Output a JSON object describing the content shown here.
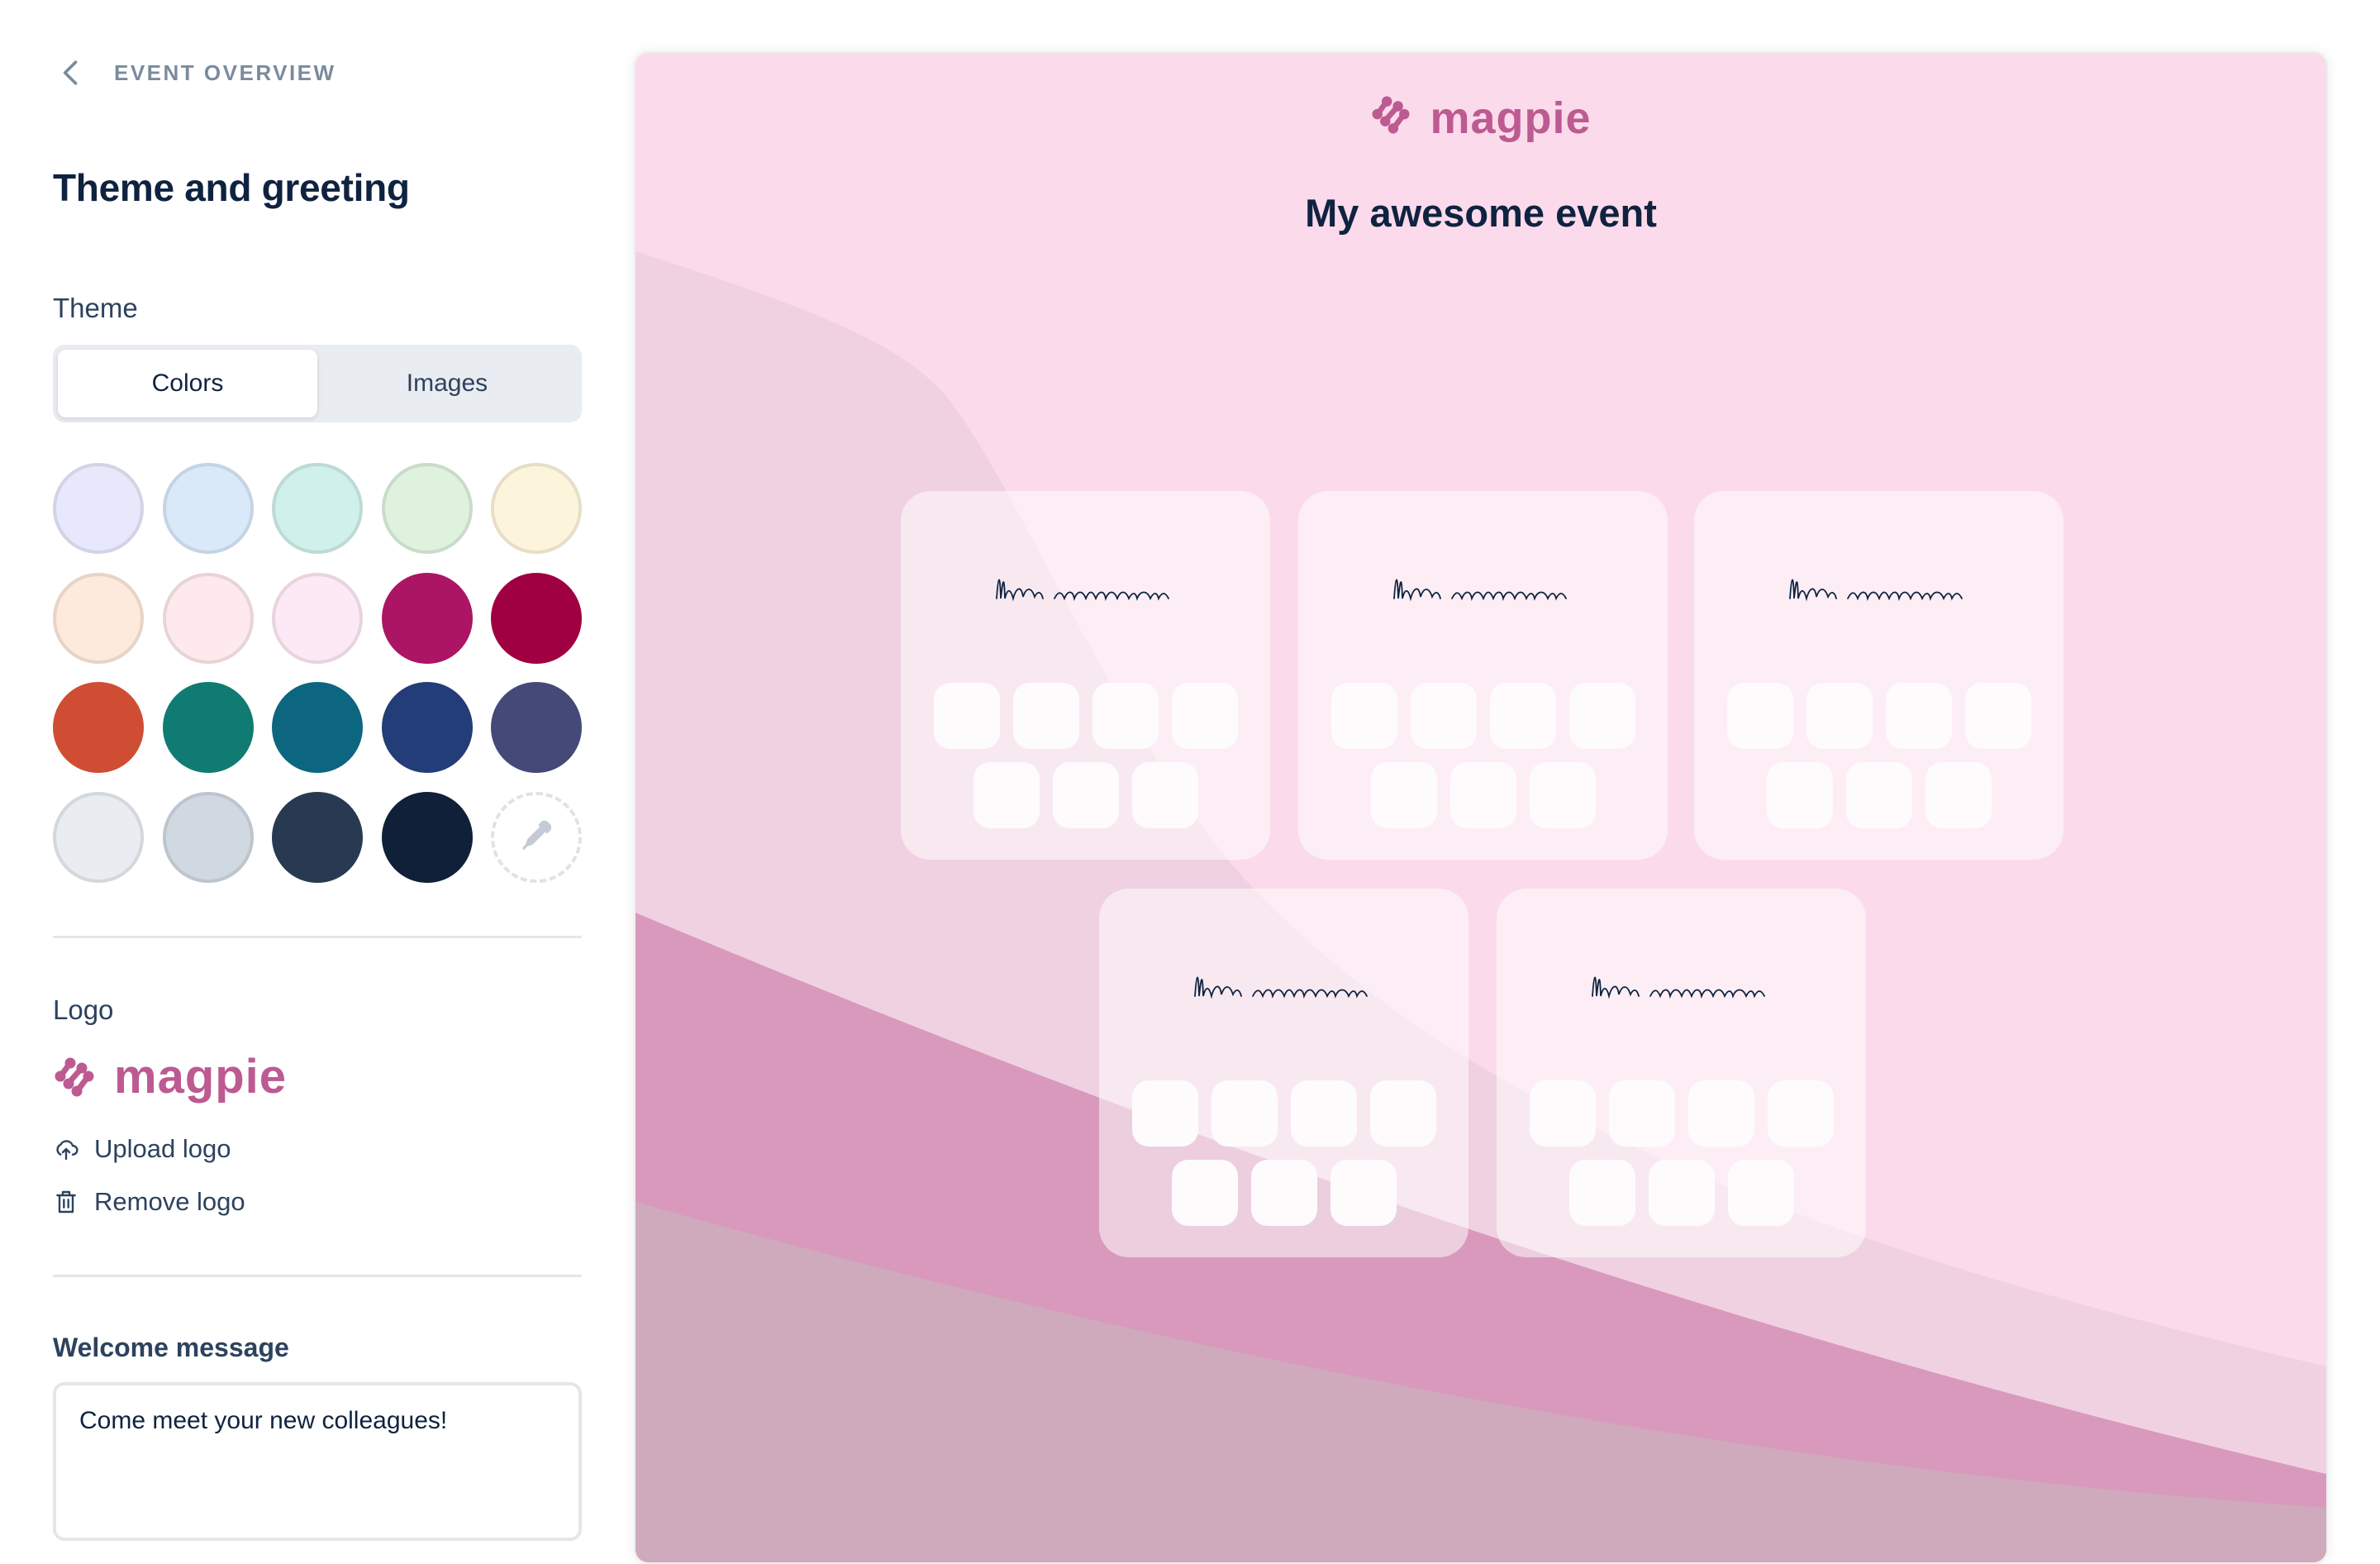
{
  "nav": {
    "back_label": "EVENT OVERVIEW"
  },
  "page_title": "Theme and greeting",
  "theme": {
    "label": "Theme",
    "tabs": [
      {
        "label": "Colors",
        "active": true
      },
      {
        "label": "Images",
        "active": false
      }
    ],
    "swatches": [
      {
        "color": "#e8e8fc",
        "light": true
      },
      {
        "color": "#d9e9fa",
        "light": true
      },
      {
        "color": "#d0f0eb",
        "light": true
      },
      {
        "color": "#dff2dd",
        "light": true
      },
      {
        "color": "#fdf5db",
        "light": true
      },
      {
        "color": "#feeadc",
        "light": true
      },
      {
        "color": "#feeaed",
        "light": true
      },
      {
        "color": "#fde9f5",
        "light": true
      },
      {
        "color": "#ab1563",
        "light": false
      },
      {
        "color": "#a00042",
        "light": false
      },
      {
        "color": "#cf4d33",
        "light": false
      },
      {
        "color": "#107b72",
        "light": false
      },
      {
        "color": "#0c6680",
        "light": false
      },
      {
        "color": "#223d77",
        "light": false
      },
      {
        "color": "#444977",
        "light": false
      },
      {
        "color": "#e9edf1",
        "light": true
      },
      {
        "color": "#d0d9e2",
        "light": true
      },
      {
        "color": "#273a52",
        "light": false
      },
      {
        "color": "#0f2038",
        "light": false
      }
    ],
    "custom_picker_icon": "eyedropper-icon"
  },
  "logo": {
    "label": "Logo",
    "brand_text": "magpie",
    "brand_color": "#bd5a92",
    "upload_label": "Upload logo",
    "remove_label": "Remove logo"
  },
  "welcome": {
    "label": "Welcome message",
    "value": "Come meet your new colleagues!"
  },
  "preview": {
    "brand_text": "magpie",
    "event_title": "My awesome event",
    "background_color": "#fbdbeb",
    "card_count": 5
  }
}
